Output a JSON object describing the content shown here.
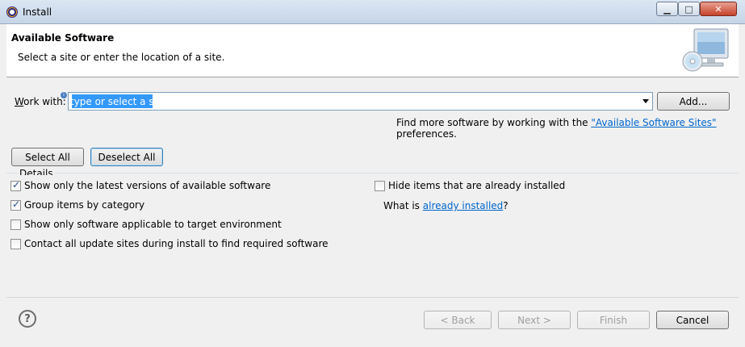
{
  "window": {
    "title": "Install"
  },
  "banner": {
    "heading": "Available Software",
    "description": "Select a site or enter the location of a site."
  },
  "work_with": {
    "label_prefix": "W",
    "label_rest": "ork with:",
    "input_value": "type or select a site",
    "add_button": "Add...",
    "more_text_before": "Find more software by working with the ",
    "more_link": "\"Available Software Sites\"",
    "more_text_after": " preferences."
  },
  "selection": {
    "select_all": "Select All",
    "deselect_all": "Deselect All"
  },
  "details": {
    "group_label": "Details",
    "options": [
      {
        "label": "Show only the latest versions of available software",
        "checked": true
      },
      {
        "label": "Group items by category",
        "checked": true
      },
      {
        "label": "Show only software applicable to target environment",
        "checked": false
      },
      {
        "label": "Contact all update sites during install to find required software",
        "checked": false
      }
    ],
    "hide_installed": {
      "label": "Hide items that are already installed",
      "checked": false
    },
    "what_is_prefix": "What is ",
    "what_is_link": "already installed",
    "what_is_suffix": "?"
  },
  "footer": {
    "back": "< Back",
    "next": "Next >",
    "finish": "Finish",
    "cancel": "Cancel"
  }
}
